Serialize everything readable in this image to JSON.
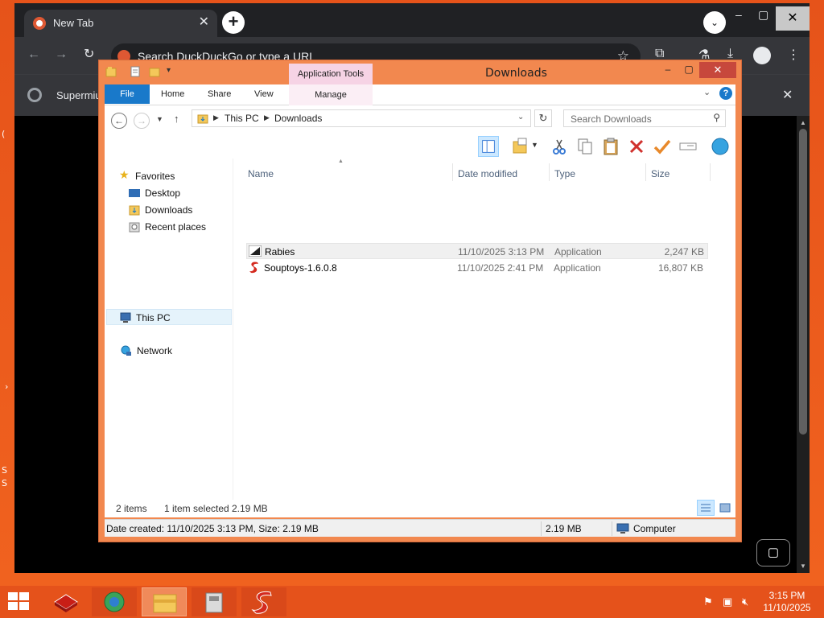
{
  "browser": {
    "tab_title": "New Tab",
    "tab_close": "✕",
    "new_tab": "+",
    "tab_search": "⌄",
    "controls": {
      "minimize": "–",
      "maximize": "▢",
      "close": "✕"
    },
    "address_placeholder": "Search DuckDuckGo or type a URL",
    "bookmark_label": "Supermiu",
    "bookmark_close": "✕",
    "feedback_icon": "speech-bubble"
  },
  "explorer": {
    "title": "Downloads",
    "contextual_tab_title": "Application Tools",
    "ribbon_tabs": [
      "File",
      "Home",
      "Share",
      "View",
      "Manage"
    ],
    "breadcrumb": [
      "This PC",
      "Downloads"
    ],
    "search_placeholder": "Search Downloads",
    "nav": {
      "favorites": "Favorites",
      "desktop": "Desktop",
      "downloads": "Downloads",
      "recent": "Recent places",
      "this_pc": "This PC",
      "network": "Network"
    },
    "columns": [
      "Name",
      "Date modified",
      "Type",
      "Size"
    ],
    "files": [
      {
        "name": "Rabies",
        "date": "11/10/2025 3:13 PM",
        "type": "Application",
        "size": "2,247 KB",
        "selected": true
      },
      {
        "name": "Souptoys-1.6.0.8",
        "date": "11/10/2025 2:41 PM",
        "type": "Application",
        "size": "16,807 KB",
        "selected": false
      }
    ],
    "status": {
      "items": "2 items",
      "selected": "1 item selected",
      "selected_size": "2.19 MB"
    },
    "details": {
      "info": "Date created: 11/10/2025 3:13 PM, Size: 2.19 MB",
      "size": "2.19 MB",
      "location": "Computer"
    }
  },
  "taskbar": {
    "clock_time": "3:15 PM",
    "clock_date": "11/10/2025"
  },
  "colors": {
    "desktop": "#e6531a",
    "explorer_frame": "#f2884f",
    "close_red": "#c7483c",
    "file_tab_blue": "#1979ca",
    "browser_dark": "#202124"
  }
}
